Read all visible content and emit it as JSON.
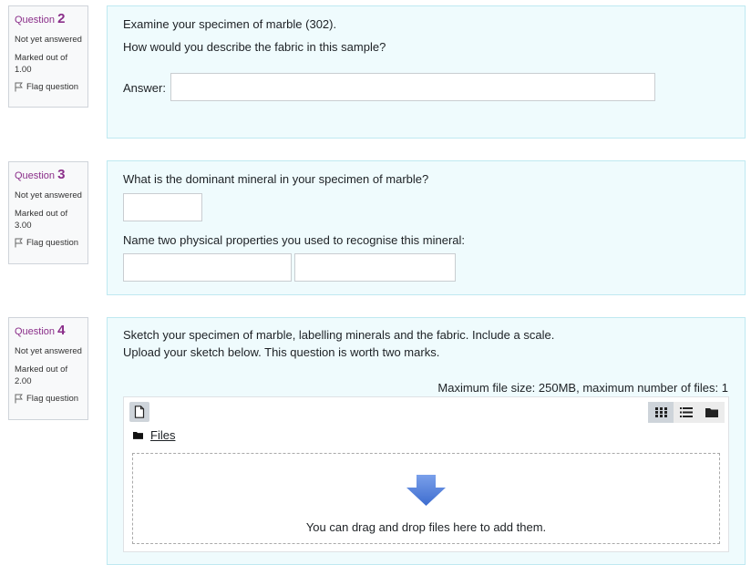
{
  "questions": [
    {
      "label": "Question",
      "number": "2",
      "status": "Not yet answered",
      "marked_label": "Marked out of",
      "marked_value": "1.00",
      "flag_label": "Flag question",
      "text_lines": [
        "Examine your specimen of marble (302).",
        "How would you describe the fabric in this sample?"
      ],
      "answer_label": "Answer:",
      "answer_value": ""
    },
    {
      "label": "Question",
      "number": "3",
      "status": "Not yet answered",
      "marked_label": "Marked out of",
      "marked_value": "3.00",
      "flag_label": "Flag question",
      "text_lines": [
        "What is the dominant mineral in your specimen of marble?",
        "Name two physical properties you used to recognise this mineral:"
      ],
      "answer_values": [
        "",
        "",
        ""
      ]
    },
    {
      "label": "Question",
      "number": "4",
      "status": "Not yet answered",
      "marked_label": "Marked out of",
      "marked_value": "2.00",
      "flag_label": "Flag question",
      "text_lines": [
        "Sketch your specimen of marble, labelling minerals and the fabric. Include a scale.",
        "Upload your sketch below. This question is worth two marks."
      ],
      "max_file_info": "Maximum file size: 250MB, maximum number of files: 1",
      "files_label": "Files",
      "dnd_text": "You can drag and drop files here to add them."
    }
  ],
  "icons": {
    "flag": "flag-icon",
    "add_file": "file-icon",
    "grid_view": "grid-view-icon",
    "list_view": "list-view-icon",
    "tree_view": "folder-icon",
    "folder": "folder-icon",
    "arrow": "arrow-down-icon"
  },
  "colors": {
    "question_accent": "#8b2f8a",
    "content_bg": "#effbfd",
    "content_border": "#bfe9f1",
    "arrow": "#5b86d9"
  }
}
